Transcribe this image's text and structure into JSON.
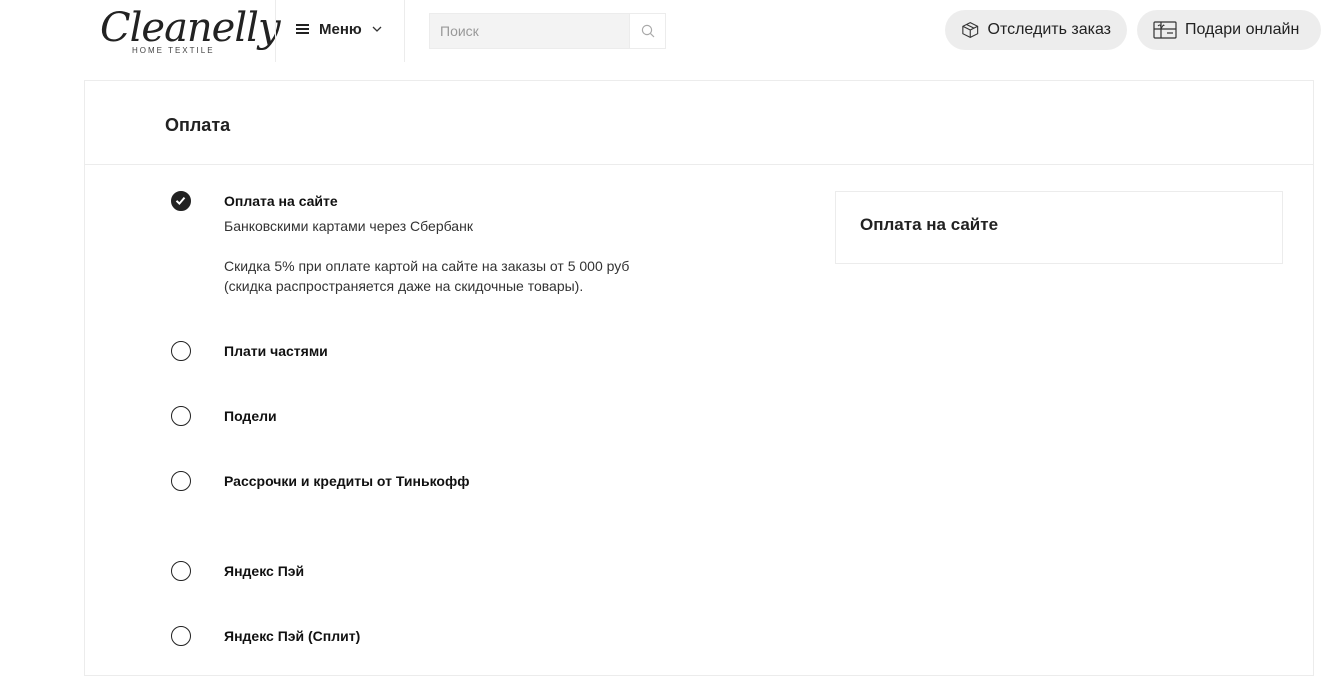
{
  "header": {
    "logo": {
      "main": "Cleanelly",
      "sub": "HOME TEXTILE"
    },
    "menu": {
      "label": "Меню",
      "icon": "burger-icon"
    },
    "search": {
      "placeholder": "Поиск",
      "value": "",
      "icon": "search-icon"
    },
    "track_order": {
      "label": "Отследить заказ",
      "icon": "box-icon"
    },
    "gift_online": {
      "label": "Подари онлайн",
      "icon": "gift-card-icon"
    }
  },
  "payment": {
    "title": "Оплата",
    "options": [
      {
        "label": "Оплата на сайте",
        "selected": true,
        "description": [
          "Банковскими картами через Сбербанк",
          "Скидка 5% при оплате картой на сайте на заказы от 5 000 руб",
          "(скидка распространяется даже на скидочные товары)."
        ]
      },
      {
        "label": "Плати частями",
        "selected": false
      },
      {
        "label": "Подели",
        "selected": false
      },
      {
        "label": "Рассрочки и кредиты от Тинькофф",
        "selected": false
      },
      {
        "label": "Яндекс Пэй",
        "selected": false
      },
      {
        "label": "Яндекс Пэй (Сплит)",
        "selected": false
      }
    ]
  },
  "summary": {
    "title": "Оплата на сайте"
  },
  "colors": {
    "text": "#222222",
    "pill_bg": "#ededed",
    "border": "#ececec",
    "search_bg": "#f3f3f3"
  }
}
